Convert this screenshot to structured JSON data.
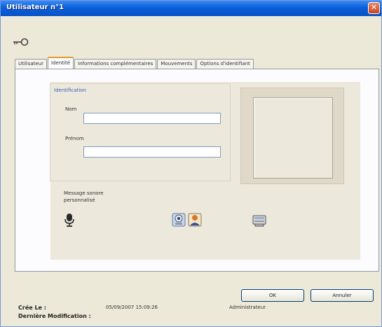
{
  "window": {
    "title": "Utilisateur n°1",
    "close_glyph": "✕"
  },
  "tabs": [
    {
      "label": "Utilisateur",
      "active": false
    },
    {
      "label": "Identité",
      "active": true
    },
    {
      "label": "Informations complémentaires",
      "active": false
    },
    {
      "label": "Mouvements",
      "active": false
    },
    {
      "label": "Options d'identifiant",
      "active": false
    }
  ],
  "identification": {
    "group_title": "Identification",
    "nom_label": "Nom",
    "nom_value": "",
    "prenom_label": "Prénom",
    "prenom_value": ""
  },
  "sound": {
    "label_line1": "Message sonore",
    "label_line2": "personnalisé"
  },
  "icons": {
    "key": "key-icon",
    "microphone": "microphone-icon",
    "webcam": "webcam-icon",
    "user_photo": "user-photo-icon",
    "scanner": "scanner-icon"
  },
  "buttons": {
    "ok": "OK",
    "cancel": "Annuler"
  },
  "footer": {
    "created_label": "Crée Le :",
    "created_value": "05/09/2007 15:09:26",
    "created_by": "Administrateur",
    "modified_label": "Dernière Modification :",
    "modified_value": ""
  },
  "colors": {
    "title_bar": "#0a5fd8",
    "accent_tab": "#e69a2d",
    "group_title": "#3b5fb0"
  }
}
